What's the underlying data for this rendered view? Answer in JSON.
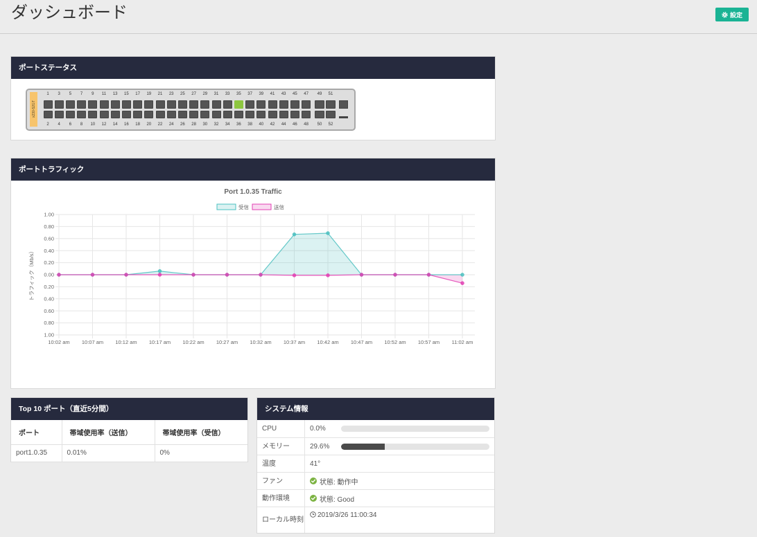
{
  "page": {
    "title": "ダッシュボード",
    "settings_label": "設定",
    "settings_icon": "gear-icon",
    "accent_color": "#1ab394",
    "panel_header_color": "#262a3e"
  },
  "port_status": {
    "heading": "ポートステータス",
    "model_label": "x230-52GT",
    "top_numbers": [
      "1",
      "3",
      "5",
      "7",
      "9",
      "11",
      "13",
      "15",
      "17",
      "19",
      "21",
      "23",
      "25",
      "27",
      "29",
      "31",
      "33",
      "35",
      "37",
      "39",
      "41",
      "43",
      "45",
      "47"
    ],
    "bottom_numbers": [
      "2",
      "4",
      "6",
      "8",
      "10",
      "12",
      "14",
      "16",
      "18",
      "20",
      "22",
      "24",
      "26",
      "28",
      "30",
      "32",
      "34",
      "36",
      "38",
      "40",
      "42",
      "44",
      "46",
      "48"
    ],
    "uplink_top_numbers": [
      "49",
      "51"
    ],
    "uplink_bottom_numbers": [
      "50",
      "52"
    ],
    "linked_ports": [
      "35"
    ],
    "link_up_color": "#8dc63f"
  },
  "port_traffic": {
    "heading": "ポートトラフィック"
  },
  "chart_data": {
    "type": "line",
    "title": "Port 1.0.35 Traffic",
    "xlabel": "",
    "ylabel": "トラフィック（Mb/s）",
    "x": [
      "10:02 am",
      "10:07 am",
      "10:12 am",
      "10:17 am",
      "10:22 am",
      "10:27 am",
      "10:32 am",
      "10:37 am",
      "10:42 am",
      "10:47 am",
      "10:52 am",
      "10:57 am",
      "11:02 am"
    ],
    "ylim": [
      -1,
      1
    ],
    "yticks": [
      1.0,
      0.8,
      0.6,
      0.4,
      0.2,
      0.0,
      -0.2,
      -0.4,
      -0.6,
      -0.8,
      -1.0
    ],
    "ytick_labels": [
      "1.00",
      "0.80",
      "0.60",
      "0.40",
      "0.20",
      "0.00",
      "0.20",
      "0.40",
      "0.60",
      "0.80",
      "1.00"
    ],
    "grid": true,
    "legend_position": "top",
    "series": [
      {
        "name": "受信",
        "color": "#4bc0c0",
        "fill": true,
        "values": [
          0,
          0,
          0,
          0.06,
          0,
          0,
          0,
          0.67,
          0.69,
          0,
          0,
          0,
          0
        ]
      },
      {
        "name": "送信",
        "color": "#e23fb3",
        "fill": true,
        "values": [
          0,
          0,
          0,
          0,
          0,
          0,
          0,
          -0.01,
          -0.01,
          0,
          0,
          0,
          -0.14
        ]
      }
    ]
  },
  "top_ports": {
    "heading": "Top 10 ポート（直近5分間）",
    "columns": [
      "ポート",
      "帯域使用率（送信）",
      "帯域使用率（受信）"
    ],
    "rows": [
      [
        "port1.0.35",
        "0.01%",
        "0%"
      ]
    ]
  },
  "system_info": {
    "heading": "システム情報",
    "status_ok_color": "#7cb342",
    "rows": [
      {
        "label": "CPU",
        "value": "0.0%",
        "bar_percent": 0.0
      },
      {
        "label": "メモリー",
        "value": "29.6%",
        "bar_percent": 29.6
      },
      {
        "label": "温度",
        "value": "41°"
      },
      {
        "label": "ファン",
        "value": "状態: 動作中",
        "icon": "check-circle-icon"
      },
      {
        "label": "動作環境",
        "value": "状態: Good",
        "icon": "check-circle-icon"
      },
      {
        "label": "ローカル時刻",
        "value": "2019/3/26 11:00:34",
        "icon": "clock-icon"
      }
    ]
  }
}
